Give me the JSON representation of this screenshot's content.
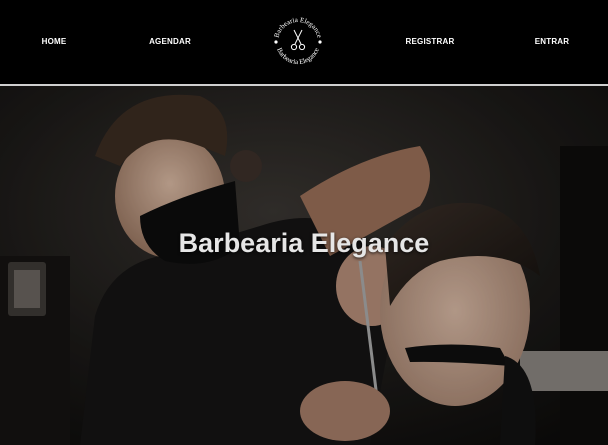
{
  "nav": {
    "home": "HOME",
    "schedule": "AGENDAR",
    "register": "REGISTRAR",
    "login": "ENTRAR"
  },
  "logo": {
    "text_top": "Barbearia Elegance",
    "text_bottom": "Barbearia Elegance",
    "icon": "scissors-icon"
  },
  "hero": {
    "title": "Barbearia Elegance"
  },
  "colors": {
    "navbar_bg": "#000000",
    "divider": "#cfcfcf",
    "hero_title": "#e6e6e6"
  }
}
